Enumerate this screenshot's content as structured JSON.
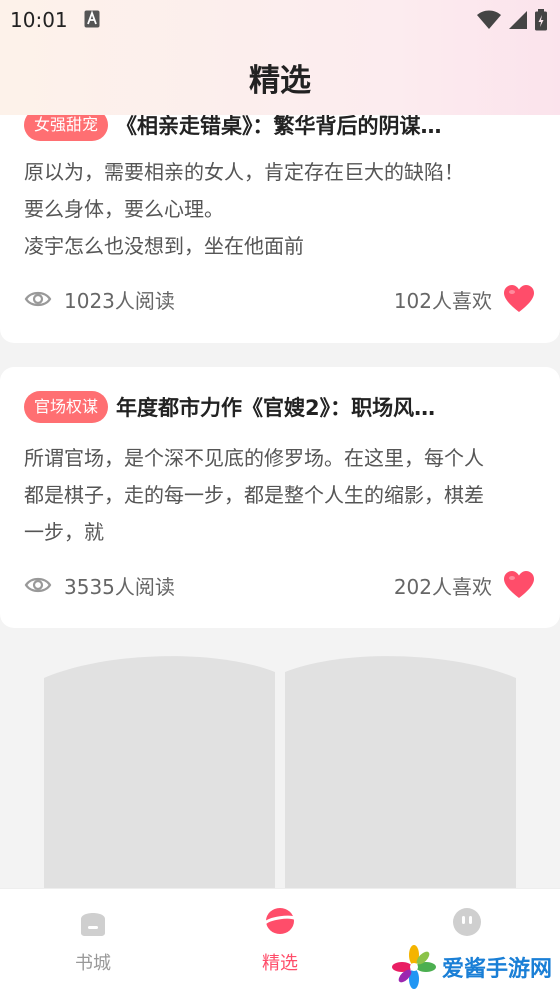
{
  "status_bar": {
    "time": "10:01"
  },
  "header": {
    "title": "精选"
  },
  "cards": [
    {
      "tag": "女强甜宠",
      "title": "《相亲走错桌》：繁华背后的阴谋…",
      "excerpt": [
        "原以为，需要相亲的女人，肯定存在巨大的缺陷！",
        "要么身体，要么心理。",
        "凌宇怎么也没想到，坐在他面前"
      ],
      "reads": "1023人阅读",
      "likes": "102人喜欢"
    },
    {
      "tag": "官场权谋",
      "title": "年度都市力作《官嫂2》：职场风…",
      "excerpt": [
        "所谓官场，是个深不见底的修罗场。在这里，每个人",
        "都是棋子，走的每一步，都是整个人生的缩影，棋差",
        "一步，就"
      ],
      "reads": "3535人阅读",
      "likes": "202人喜欢"
    }
  ],
  "bottom_nav": {
    "items": [
      {
        "label": "书城",
        "icon": "bookstore-icon"
      },
      {
        "label": "精选",
        "icon": "featured-icon",
        "active": true
      },
      {
        "label": "",
        "icon": "profile-icon"
      }
    ]
  },
  "watermark": {
    "text": "爱酱手游网"
  },
  "colors": {
    "accent": "#ff4d6a",
    "tag_bg": "#ff6f72",
    "heart": "#ff4d6a"
  }
}
